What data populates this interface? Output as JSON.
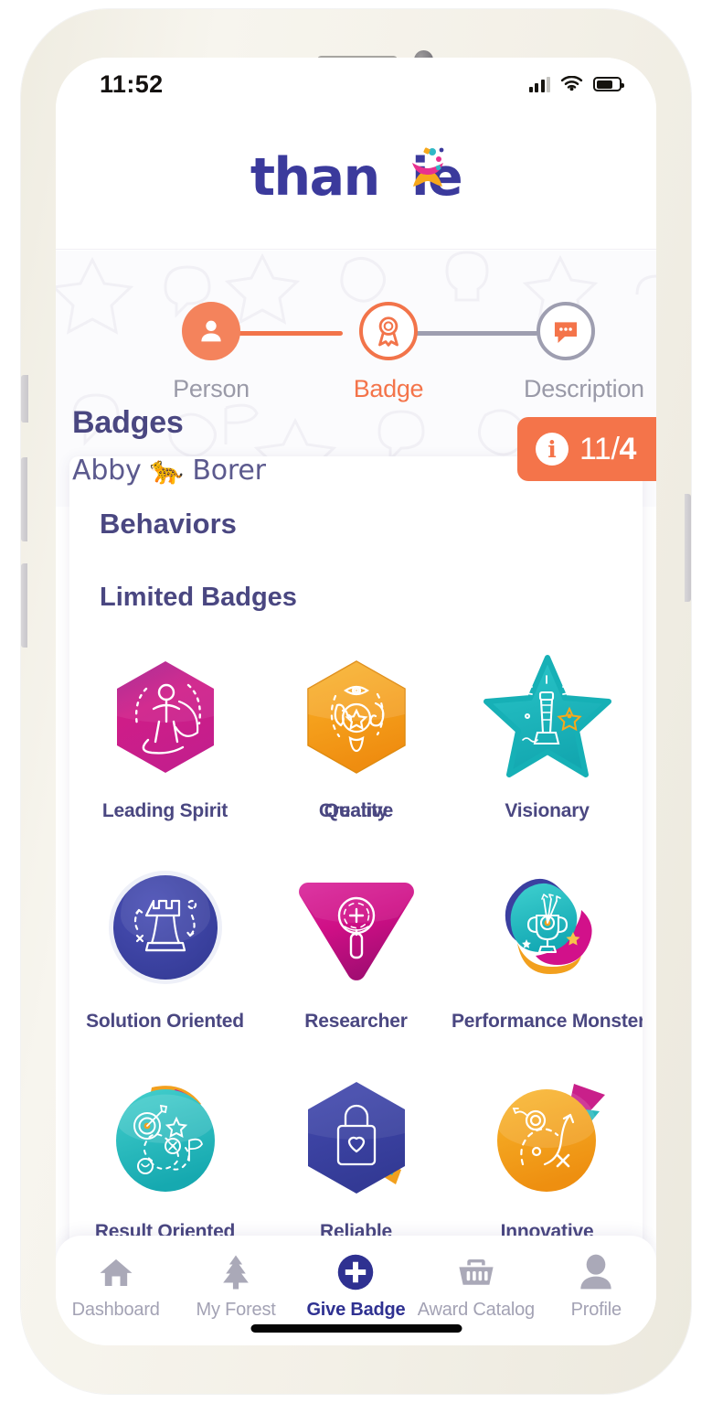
{
  "status_bar": {
    "time": "11:52",
    "signal_icon": "cellular-signal-icon",
    "wifi_icon": "wifi-icon",
    "battery_icon": "battery-icon",
    "battery_level_percent": 72,
    "signal_bars_filled": 3,
    "signal_bars_total": 4
  },
  "brand": {
    "name": "thanxie",
    "text_before": "than",
    "text_after": "ie",
    "logo_color": "#3b3a9c",
    "accent_colors": [
      "#e8318f",
      "#f7a81b",
      "#2fb8c6",
      "#f4744a"
    ]
  },
  "stepper": {
    "steps": [
      {
        "label": "Person",
        "state": "completed",
        "icon": "person-icon"
      },
      {
        "label": "Badge",
        "state": "current",
        "icon": "award-ribbon-icon"
      },
      {
        "label": "Description",
        "state": "upcoming",
        "icon": "chat-bubble-icon"
      }
    ],
    "active_color": "#f4744a",
    "inactive_color": "#9a9aa8"
  },
  "header": {
    "title": "Badges",
    "recipient": "Abby 🐆 Borer",
    "counter": {
      "icon": "info-icon",
      "current": "11",
      "separator": "/",
      "limit": "4",
      "full_text": "11/4",
      "background": "#f4744a"
    }
  },
  "card": {
    "title": "Behaviors",
    "section_title": "Limited Badges",
    "badges": [
      {
        "name": "Leading Spirit",
        "shape": "hexagon",
        "color": "#c9208a",
        "icon": "superhero-icon"
      },
      {
        "name": "Creative",
        "overlapping_name": "Quality",
        "shape": "hexagon",
        "color": "#f2a01e",
        "icon": "senses-star-icon"
      },
      {
        "name": "Visionary",
        "shape": "star",
        "color": "#1fb8bd",
        "icon": "lighthouse-icon"
      },
      {
        "name": "Solution Oriented",
        "shape": "circle",
        "color": "#3b3fa0",
        "icon": "chess-rook-icon"
      },
      {
        "name": "Researcher",
        "shape": "triangle-down",
        "color": "#d2118a",
        "icon": "magnifier-plus-icon"
      },
      {
        "name": "Performance Monster",
        "shape": "blob",
        "color": "#1fb8bd",
        "icon": "trophy-arrows-icon"
      },
      {
        "name": "Result Oriented",
        "shape": "circle",
        "color": "#2bb9bd",
        "icon": "target-path-icon"
      },
      {
        "name": "Reliable",
        "shape": "hexagon",
        "color": "#3b3fa0",
        "icon": "lock-heart-icon"
      },
      {
        "name": "Innovative",
        "shape": "circle",
        "color": "#f2a01e",
        "icon": "arrow-path-icon"
      }
    ]
  },
  "bottom_nav": {
    "items": [
      {
        "label": "Dashboard",
        "icon": "home-icon",
        "active": false
      },
      {
        "label": "My Forest",
        "icon": "tree-icon",
        "active": false
      },
      {
        "label": "Give Badge",
        "icon": "plus-circle-icon",
        "active": true
      },
      {
        "label": "Award Catalog",
        "icon": "basket-icon",
        "active": false
      },
      {
        "label": "Profile",
        "icon": "person-avatar-icon",
        "active": false
      }
    ],
    "active_color": "#2f3191",
    "inactive_color": "#a3a2b4"
  },
  "device": {
    "frame_color": "#f2efe6",
    "speaker_icon": "speaker-grille",
    "camera_icon": "front-camera",
    "home_indicator": "home-indicator-bar"
  }
}
